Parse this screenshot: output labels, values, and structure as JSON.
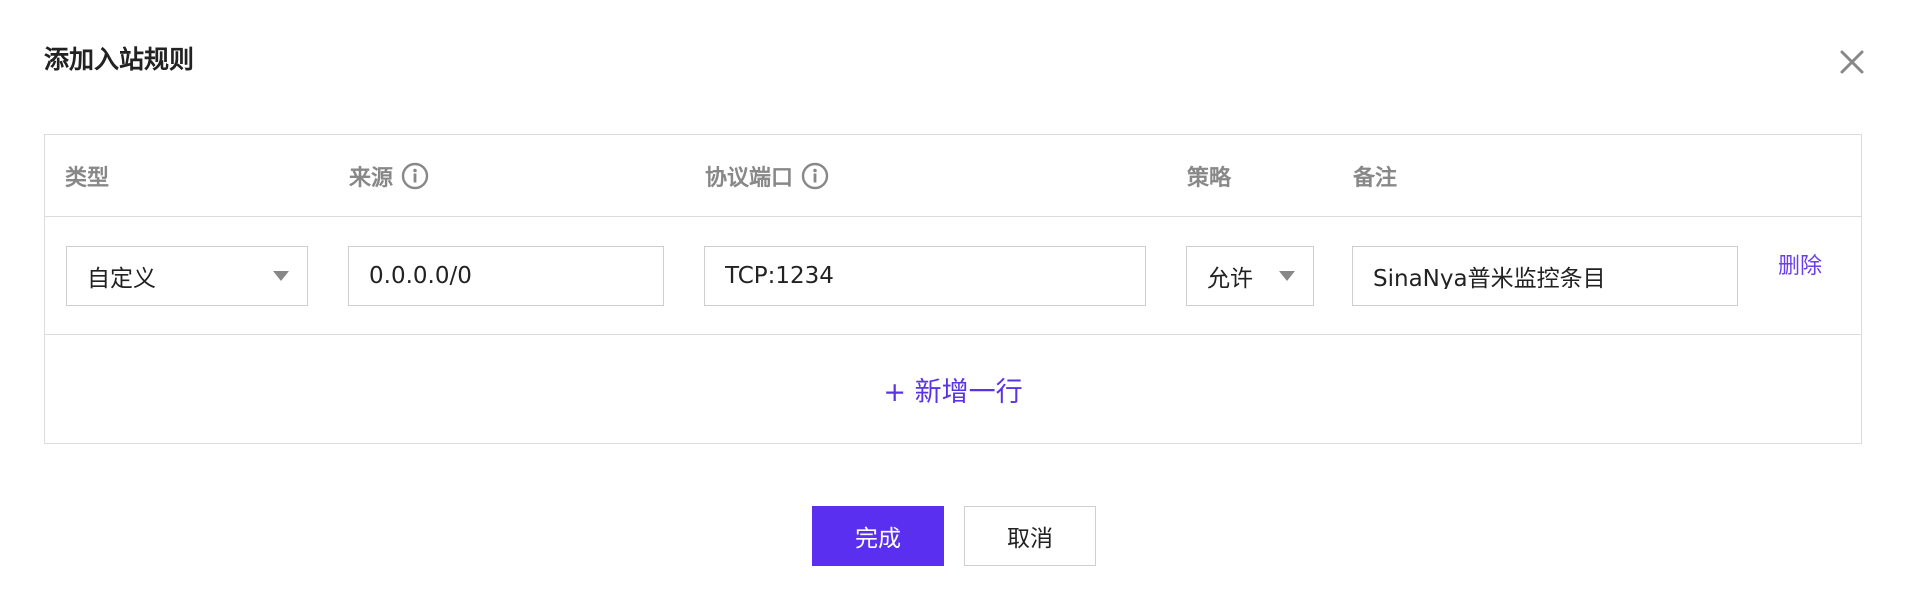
{
  "dialog": {
    "title": "添加入站规则",
    "close_icon": "close-icon"
  },
  "table": {
    "headers": {
      "type": "类型",
      "source": "来源",
      "protocol_port": "协议端口",
      "policy": "策略",
      "remark": "备注"
    },
    "info_icon": "info-icon",
    "rows": [
      {
        "type": "自定义",
        "source": "0.0.0.0/0",
        "protocol_port": "TCP:1234",
        "policy": "允许",
        "remark": "SinaNya普米监控条目",
        "delete_label": "删除"
      }
    ],
    "add_row_label": "+ 新增一行"
  },
  "footer": {
    "confirm_label": "完成",
    "cancel_label": "取消"
  },
  "colors": {
    "accent": "#5b2ff0",
    "link": "#6a3df0",
    "header_text": "#888888",
    "border": "#dcdcdc"
  }
}
